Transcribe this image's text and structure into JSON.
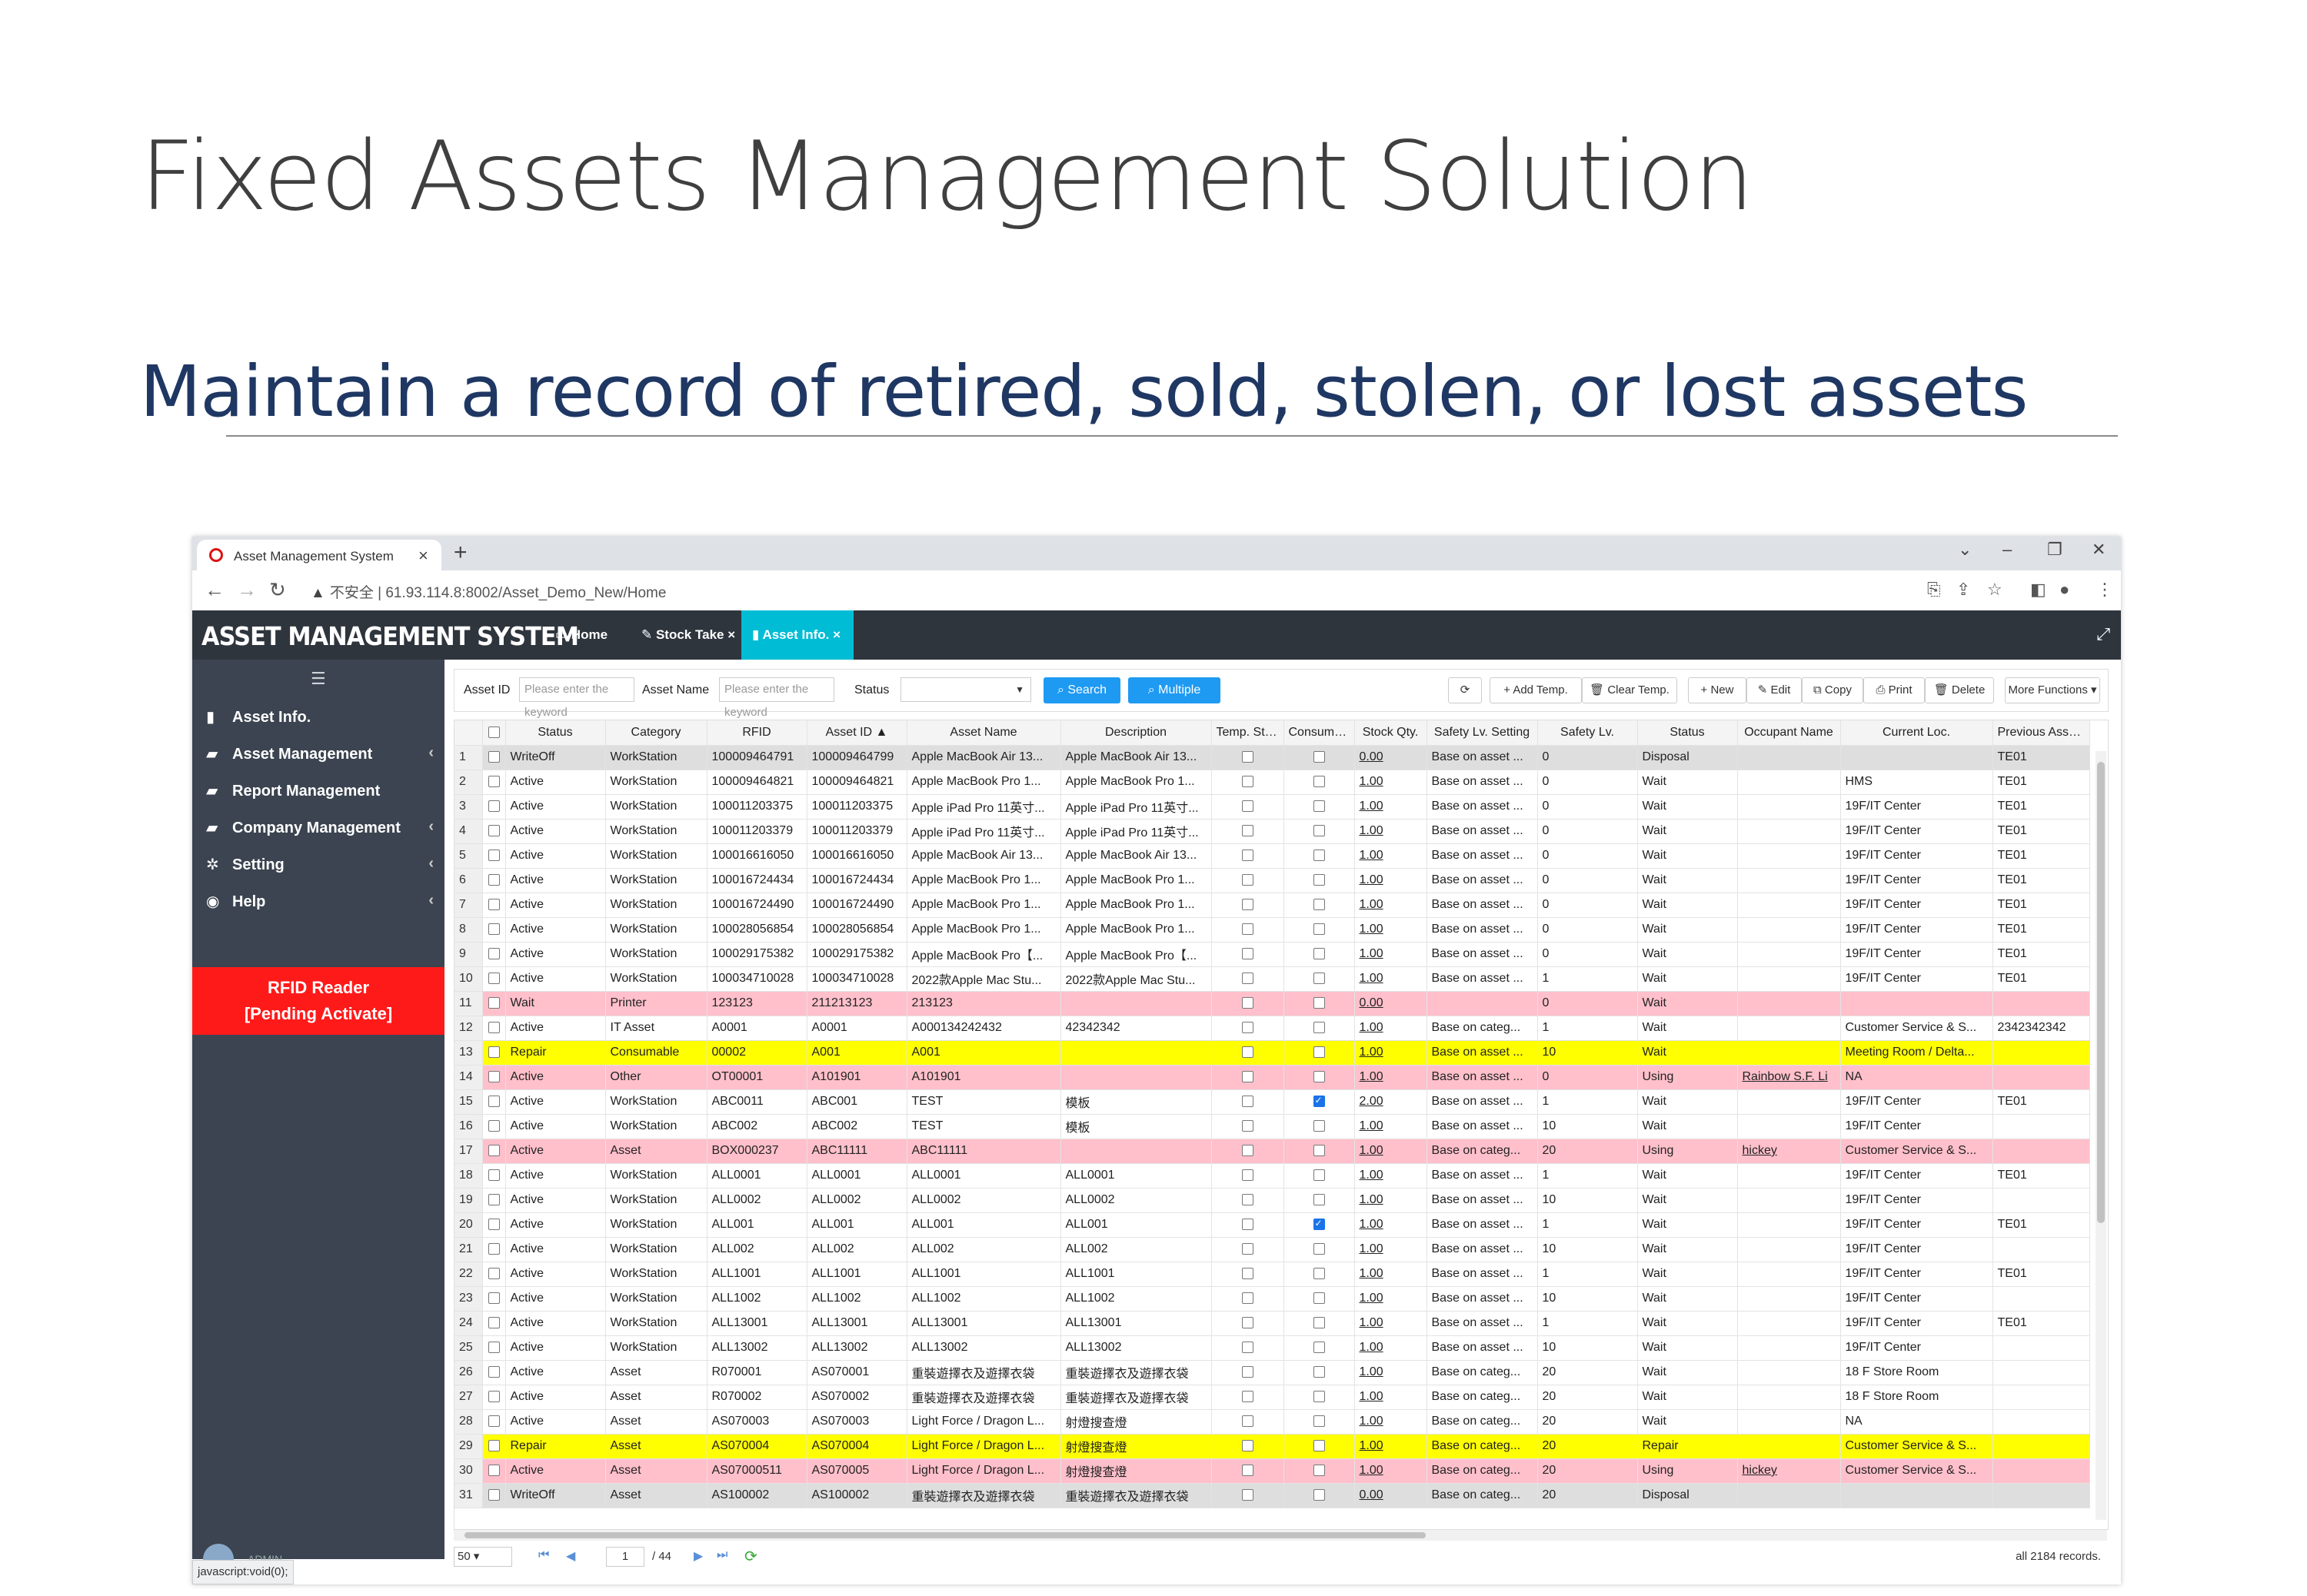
{
  "slide": {
    "title": "Fixed Assets Management Solution",
    "subtitle": "Maintain a record of retired, sold, stolen, or lost assets"
  },
  "browser": {
    "tab_title": "Asset Management System",
    "url_warning": "不安全",
    "url": "61.93.114.8:8002/Asset_Demo_New/Home",
    "status_url": "javascript:void(0);"
  },
  "app": {
    "brand": "ASSET MANAGEMENT SYSTEM",
    "tabs": [
      {
        "label": "Home",
        "icon": "monitor-icon"
      },
      {
        "label": "Stock Take",
        "icon": "pencil-icon"
      },
      {
        "label": "Asset Info.",
        "icon": "bookmark-icon"
      }
    ],
    "sidebar": [
      {
        "label": "Asset Info.",
        "icon": "bookmark-icon",
        "chevron": false
      },
      {
        "label": "Asset Management",
        "icon": "book-icon",
        "chevron": true
      },
      {
        "label": "Report Management",
        "icon": "book-icon",
        "chevron": false
      },
      {
        "label": "Company Management",
        "icon": "book-icon",
        "chevron": true
      },
      {
        "label": "Setting",
        "icon": "gear-icon",
        "chevron": true
      },
      {
        "label": "Help",
        "icon": "eye-icon",
        "chevron": true
      }
    ],
    "rfid": {
      "line1": "RFID Reader",
      "line2": "[Pending Activate]"
    },
    "admin": "ADMIN"
  },
  "toolbar": {
    "asset_id_label": "Asset ID",
    "asset_id_placeholder": "Please enter the keyword",
    "asset_name_label": "Asset Name",
    "asset_name_placeholder": "Please enter the keyword",
    "status_label": "Status",
    "search": "Search",
    "multiple": "Multiple",
    "refresh": "⟳",
    "add_temp": "Add Temp.",
    "clear_temp": "Clear Temp.",
    "new": "New",
    "edit": "Edit",
    "copy": "Copy",
    "print": "Print",
    "delete": "Delete",
    "more": "More Functions ▾"
  },
  "table": {
    "columns": [
      "",
      "",
      "Status",
      "Category",
      "RFID",
      "Asset ID ▲",
      "Asset Name",
      "Description",
      "Temp. Stora",
      "Consumabl",
      "Stock Qty.",
      "Safety Lv. Setting",
      "Safety Lv.",
      "Status",
      "Occupant Name",
      "Current Loc.",
      "Previous Asset ID"
    ],
    "rows": [
      {
        "n": "1",
        "status": "WriteOff",
        "category": "WorkStation",
        "rfid": "100009464791",
        "asset_id": "100009464799",
        "name": "Apple MacBook Air 13...",
        "desc": "Apple MacBook Air 13...",
        "temp": false,
        "cons": false,
        "qty": "0.00",
        "safety_set": "Base on asset ...",
        "safety": "0",
        "status2": "Disposal",
        "occupant": "",
        "loc": "",
        "prev": "TE01",
        "color": "gray"
      },
      {
        "n": "2",
        "status": "Active",
        "category": "WorkStation",
        "rfid": "100009464821",
        "asset_id": "100009464821",
        "name": "Apple MacBook Pro 1...",
        "desc": "Apple MacBook Pro 1...",
        "temp": false,
        "cons": false,
        "qty": "1.00",
        "safety_set": "Base on asset ...",
        "safety": "0",
        "status2": "Wait",
        "occupant": "",
        "loc": "HMS",
        "prev": "TE01",
        "color": ""
      },
      {
        "n": "3",
        "status": "Active",
        "category": "WorkStation",
        "rfid": "100011203375",
        "asset_id": "100011203375",
        "name": "Apple iPad Pro 11英寸...",
        "desc": "Apple iPad Pro 11英寸...",
        "temp": false,
        "cons": false,
        "qty": "1.00",
        "safety_set": "Base on asset ...",
        "safety": "0",
        "status2": "Wait",
        "occupant": "",
        "loc": "19F/IT Center",
        "prev": "TE01",
        "color": ""
      },
      {
        "n": "4",
        "status": "Active",
        "category": "WorkStation",
        "rfid": "100011203379",
        "asset_id": "100011203379",
        "name": "Apple iPad Pro 11英寸...",
        "desc": "Apple iPad Pro 11英寸...",
        "temp": false,
        "cons": false,
        "qty": "1.00",
        "safety_set": "Base on asset ...",
        "safety": "0",
        "status2": "Wait",
        "occupant": "",
        "loc": "19F/IT Center",
        "prev": "TE01",
        "color": ""
      },
      {
        "n": "5",
        "status": "Active",
        "category": "WorkStation",
        "rfid": "100016616050",
        "asset_id": "100016616050",
        "name": "Apple MacBook Air 13...",
        "desc": "Apple MacBook Air 13...",
        "temp": false,
        "cons": false,
        "qty": "1.00",
        "safety_set": "Base on asset ...",
        "safety": "0",
        "status2": "Wait",
        "occupant": "",
        "loc": "19F/IT Center",
        "prev": "TE01",
        "color": ""
      },
      {
        "n": "6",
        "status": "Active",
        "category": "WorkStation",
        "rfid": "100016724434",
        "asset_id": "100016724434",
        "name": "Apple MacBook Pro 1...",
        "desc": "Apple MacBook Pro 1...",
        "temp": false,
        "cons": false,
        "qty": "1.00",
        "safety_set": "Base on asset ...",
        "safety": "0",
        "status2": "Wait",
        "occupant": "",
        "loc": "19F/IT Center",
        "prev": "TE01",
        "color": ""
      },
      {
        "n": "7",
        "status": "Active",
        "category": "WorkStation",
        "rfid": "100016724490",
        "asset_id": "100016724490",
        "name": "Apple MacBook Pro 1...",
        "desc": "Apple MacBook Pro 1...",
        "temp": false,
        "cons": false,
        "qty": "1.00",
        "safety_set": "Base on asset ...",
        "safety": "0",
        "status2": "Wait",
        "occupant": "",
        "loc": "19F/IT Center",
        "prev": "TE01",
        "color": ""
      },
      {
        "n": "8",
        "status": "Active",
        "category": "WorkStation",
        "rfid": "100028056854",
        "asset_id": "100028056854",
        "name": "Apple MacBook Pro 1...",
        "desc": "Apple MacBook Pro 1...",
        "temp": false,
        "cons": false,
        "qty": "1.00",
        "safety_set": "Base on asset ...",
        "safety": "0",
        "status2": "Wait",
        "occupant": "",
        "loc": "19F/IT Center",
        "prev": "TE01",
        "color": ""
      },
      {
        "n": "9",
        "status": "Active",
        "category": "WorkStation",
        "rfid": "100029175382",
        "asset_id": "100029175382",
        "name": "Apple MacBook Pro【...",
        "desc": "Apple MacBook Pro【...",
        "temp": false,
        "cons": false,
        "qty": "1.00",
        "safety_set": "Base on asset ...",
        "safety": "0",
        "status2": "Wait",
        "occupant": "",
        "loc": "19F/IT Center",
        "prev": "TE01",
        "color": ""
      },
      {
        "n": "10",
        "status": "Active",
        "category": "WorkStation",
        "rfid": "100034710028",
        "asset_id": "100034710028",
        "name": "2022款Apple Mac Stu...",
        "desc": "2022款Apple Mac Stu...",
        "temp": false,
        "cons": false,
        "qty": "1.00",
        "safety_set": "Base on asset ...",
        "safety": "1",
        "status2": "Wait",
        "occupant": "",
        "loc": "19F/IT Center",
        "prev": "TE01",
        "color": ""
      },
      {
        "n": "11",
        "status": "Wait",
        "category": "Printer",
        "rfid": "123123",
        "asset_id": "211213123",
        "name": "213123",
        "desc": "",
        "temp": false,
        "cons": false,
        "qty": "0.00",
        "safety_set": "",
        "safety": "0",
        "status2": "Wait",
        "occupant": "",
        "loc": "",
        "prev": "",
        "color": "pink"
      },
      {
        "n": "12",
        "status": "Active",
        "category": "IT Asset",
        "rfid": "A0001",
        "asset_id": "A0001",
        "name": "A000134242432",
        "desc": "42342342",
        "temp": false,
        "cons": false,
        "qty": "1.00",
        "safety_set": "Base on categ...",
        "safety": "1",
        "status2": "Wait",
        "occupant": "",
        "loc": "Customer Service & S...",
        "prev": "2342342342",
        "color": ""
      },
      {
        "n": "13",
        "status": "Repair",
        "category": "Consumable",
        "rfid": "00002",
        "asset_id": "A001",
        "name": "A001",
        "desc": "",
        "temp": false,
        "cons": false,
        "qty": "1.00",
        "safety_set": "Base on asset ...",
        "safety": "10",
        "status2": "Wait",
        "occupant": "",
        "loc": "Meeting Room / Delta...",
        "prev": "",
        "color": "yellow"
      },
      {
        "n": "14",
        "status": "Active",
        "category": "Other",
        "rfid": "OT00001",
        "asset_id": "A101901",
        "name": "A101901",
        "desc": "",
        "temp": false,
        "cons": false,
        "qty": "1.00",
        "safety_set": "Base on asset ...",
        "safety": "0",
        "status2": "Using",
        "occupant": "Rainbow S.F. Li",
        "loc": "NA",
        "prev": "",
        "color": "pink"
      },
      {
        "n": "15",
        "status": "Active",
        "category": "WorkStation",
        "rfid": "ABC0011",
        "asset_id": "ABC001",
        "name": "TEST",
        "desc": "模板",
        "temp": false,
        "cons": true,
        "qty": "2.00",
        "safety_set": "Base on asset ...",
        "safety": "1",
        "status2": "Wait",
        "occupant": "",
        "loc": "19F/IT Center",
        "prev": "TE01",
        "color": ""
      },
      {
        "n": "16",
        "status": "Active",
        "category": "WorkStation",
        "rfid": "ABC002",
        "asset_id": "ABC002",
        "name": "TEST",
        "desc": "模板",
        "temp": false,
        "cons": false,
        "qty": "1.00",
        "safety_set": "Base on asset ...",
        "safety": "10",
        "status2": "Wait",
        "occupant": "",
        "loc": "19F/IT Center",
        "prev": "",
        "color": ""
      },
      {
        "n": "17",
        "status": "Active",
        "category": "Asset",
        "rfid": "BOX000237",
        "asset_id": "ABC11111",
        "name": "ABC11111",
        "desc": "",
        "temp": false,
        "cons": false,
        "qty": "1.00",
        "safety_set": "Base on categ...",
        "safety": "20",
        "status2": "Using",
        "occupant": "hickey",
        "loc": "Customer Service & S...",
        "prev": "",
        "color": "pink"
      },
      {
        "n": "18",
        "status": "Active",
        "category": "WorkStation",
        "rfid": "ALL0001",
        "asset_id": "ALL0001",
        "name": "ALL0001",
        "desc": "ALL0001",
        "temp": false,
        "cons": false,
        "qty": "1.00",
        "safety_set": "Base on asset ...",
        "safety": "1",
        "status2": "Wait",
        "occupant": "",
        "loc": "19F/IT Center",
        "prev": "TE01",
        "color": ""
      },
      {
        "n": "19",
        "status": "Active",
        "category": "WorkStation",
        "rfid": "ALL0002",
        "asset_id": "ALL0002",
        "name": "ALL0002",
        "desc": "ALL0002",
        "temp": false,
        "cons": false,
        "qty": "1.00",
        "safety_set": "Base on asset ...",
        "safety": "10",
        "status2": "Wait",
        "occupant": "",
        "loc": "19F/IT Center",
        "prev": "",
        "color": ""
      },
      {
        "n": "20",
        "status": "Active",
        "category": "WorkStation",
        "rfid": "ALL001",
        "asset_id": "ALL001",
        "name": "ALL001",
        "desc": "ALL001",
        "temp": false,
        "cons": true,
        "qty": "1.00",
        "safety_set": "Base on asset ...",
        "safety": "1",
        "status2": "Wait",
        "occupant": "",
        "loc": "19F/IT Center",
        "prev": "TE01",
        "color": ""
      },
      {
        "n": "21",
        "status": "Active",
        "category": "WorkStation",
        "rfid": "ALL002",
        "asset_id": "ALL002",
        "name": "ALL002",
        "desc": "ALL002",
        "temp": false,
        "cons": false,
        "qty": "1.00",
        "safety_set": "Base on asset ...",
        "safety": "10",
        "status2": "Wait",
        "occupant": "",
        "loc": "19F/IT Center",
        "prev": "",
        "color": ""
      },
      {
        "n": "22",
        "status": "Active",
        "category": "WorkStation",
        "rfid": "ALL1001",
        "asset_id": "ALL1001",
        "name": "ALL1001",
        "desc": "ALL1001",
        "temp": false,
        "cons": false,
        "qty": "1.00",
        "safety_set": "Base on asset ...",
        "safety": "1",
        "status2": "Wait",
        "occupant": "",
        "loc": "19F/IT Center",
        "prev": "TE01",
        "color": ""
      },
      {
        "n": "23",
        "status": "Active",
        "category": "WorkStation",
        "rfid": "ALL1002",
        "asset_id": "ALL1002",
        "name": "ALL1002",
        "desc": "ALL1002",
        "temp": false,
        "cons": false,
        "qty": "1.00",
        "safety_set": "Base on asset ...",
        "safety": "10",
        "status2": "Wait",
        "occupant": "",
        "loc": "19F/IT Center",
        "prev": "",
        "color": ""
      },
      {
        "n": "24",
        "status": "Active",
        "category": "WorkStation",
        "rfid": "ALL13001",
        "asset_id": "ALL13001",
        "name": "ALL13001",
        "desc": "ALL13001",
        "temp": false,
        "cons": false,
        "qty": "1.00",
        "safety_set": "Base on asset ...",
        "safety": "1",
        "status2": "Wait",
        "occupant": "",
        "loc": "19F/IT Center",
        "prev": "TE01",
        "color": ""
      },
      {
        "n": "25",
        "status": "Active",
        "category": "WorkStation",
        "rfid": "ALL13002",
        "asset_id": "ALL13002",
        "name": "ALL13002",
        "desc": "ALL13002",
        "temp": false,
        "cons": false,
        "qty": "1.00",
        "safety_set": "Base on asset ...",
        "safety": "10",
        "status2": "Wait",
        "occupant": "",
        "loc": "19F/IT Center",
        "prev": "",
        "color": ""
      },
      {
        "n": "26",
        "status": "Active",
        "category": "Asset",
        "rfid": "R070001",
        "asset_id": "AS070001",
        "name": "重裝遊擇衣及遊擇衣袋",
        "desc": "重裝遊擇衣及遊擇衣袋",
        "temp": false,
        "cons": false,
        "qty": "1.00",
        "safety_set": "Base on categ...",
        "safety": "20",
        "status2": "Wait",
        "occupant": "",
        "loc": "18 F Store Room",
        "prev": "",
        "color": ""
      },
      {
        "n": "27",
        "status": "Active",
        "category": "Asset",
        "rfid": "R070002",
        "asset_id": "AS070002",
        "name": "重裝遊擇衣及遊擇衣袋",
        "desc": "重裝遊擇衣及遊擇衣袋",
        "temp": false,
        "cons": false,
        "qty": "1.00",
        "safety_set": "Base on categ...",
        "safety": "20",
        "status2": "Wait",
        "occupant": "",
        "loc": "18 F Store Room",
        "prev": "",
        "color": ""
      },
      {
        "n": "28",
        "status": "Active",
        "category": "Asset",
        "rfid": "AS070003",
        "asset_id": "AS070003",
        "name": "Light Force / Dragon L...",
        "desc": "射燈搜查燈",
        "temp": false,
        "cons": false,
        "qty": "1.00",
        "safety_set": "Base on categ...",
        "safety": "20",
        "status2": "Wait",
        "occupant": "",
        "loc": "NA",
        "prev": "",
        "color": ""
      },
      {
        "n": "29",
        "status": "Repair",
        "category": "Asset",
        "rfid": "AS070004",
        "asset_id": "AS070004",
        "name": "Light Force / Dragon L...",
        "desc": "射燈搜查燈",
        "temp": false,
        "cons": false,
        "qty": "1.00",
        "safety_set": "Base on categ...",
        "safety": "20",
        "status2": "Repair",
        "occupant": "",
        "loc": "Customer Service & S...",
        "prev": "",
        "color": "yellow"
      },
      {
        "n": "30",
        "status": "Active",
        "category": "Asset",
        "rfid": "AS07000511",
        "asset_id": "AS070005",
        "name": "Light Force / Dragon L...",
        "desc": "射燈搜查燈",
        "temp": false,
        "cons": false,
        "qty": "1.00",
        "safety_set": "Base on categ...",
        "safety": "20",
        "status2": "Using",
        "occupant": "hickey",
        "loc": "Customer Service & S...",
        "prev": "",
        "color": "pink"
      },
      {
        "n": "31",
        "status": "WriteOff",
        "category": "Asset",
        "rfid": "AS100002",
        "asset_id": "AS100002",
        "name": "重裝遊擇衣及遊擇衣袋",
        "desc": "重裝遊擇衣及遊擇衣袋",
        "temp": false,
        "cons": false,
        "qty": "0.00",
        "safety_set": "Base on categ...",
        "safety": "20",
        "status2": "Disposal",
        "occupant": "",
        "loc": "",
        "prev": "",
        "color": "gray"
      }
    ]
  },
  "pager": {
    "page_size": "50",
    "current_page": "1",
    "total_pages": "/ 44",
    "records": "all 2184 records."
  }
}
